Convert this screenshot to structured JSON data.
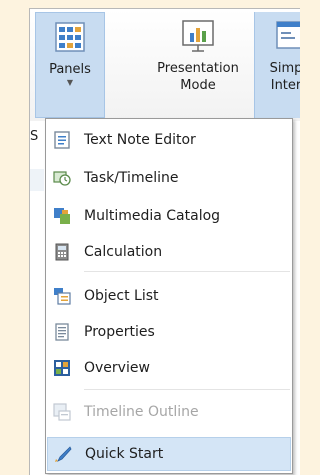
{
  "ribbon": {
    "panels_label": "Panels",
    "presentation_label_line1": "Presentation",
    "presentation_label_line2": "Mode",
    "simple_label_line1": "Simp",
    "simple_label_line2": "Inter",
    "side_letter": "S"
  },
  "menu": {
    "items": [
      {
        "label": "Text Note Editor",
        "icon": "text-note-icon",
        "enabled": true
      },
      {
        "label": "Task/Timeline",
        "icon": "task-timeline-icon",
        "enabled": true
      },
      {
        "label": "Multimedia Catalog",
        "icon": "multimedia-catalog-icon",
        "enabled": true
      },
      {
        "label": "Calculation",
        "icon": "calculator-icon",
        "enabled": true
      },
      {
        "label": "Object List",
        "icon": "object-list-icon",
        "enabled": true
      },
      {
        "label": "Properties",
        "icon": "properties-icon",
        "enabled": true
      },
      {
        "label": "Overview",
        "icon": "overview-icon",
        "enabled": true
      },
      {
        "label": "Timeline Outline",
        "icon": "timeline-outline-icon",
        "enabled": false
      },
      {
        "label": "Quick Start",
        "icon": "quick-start-icon",
        "enabled": true,
        "highlighted": true
      }
    ]
  },
  "colors": {
    "background": "#fdf3df",
    "highlight": "#d4e5f6",
    "disabled_text": "#a6a6a6"
  }
}
